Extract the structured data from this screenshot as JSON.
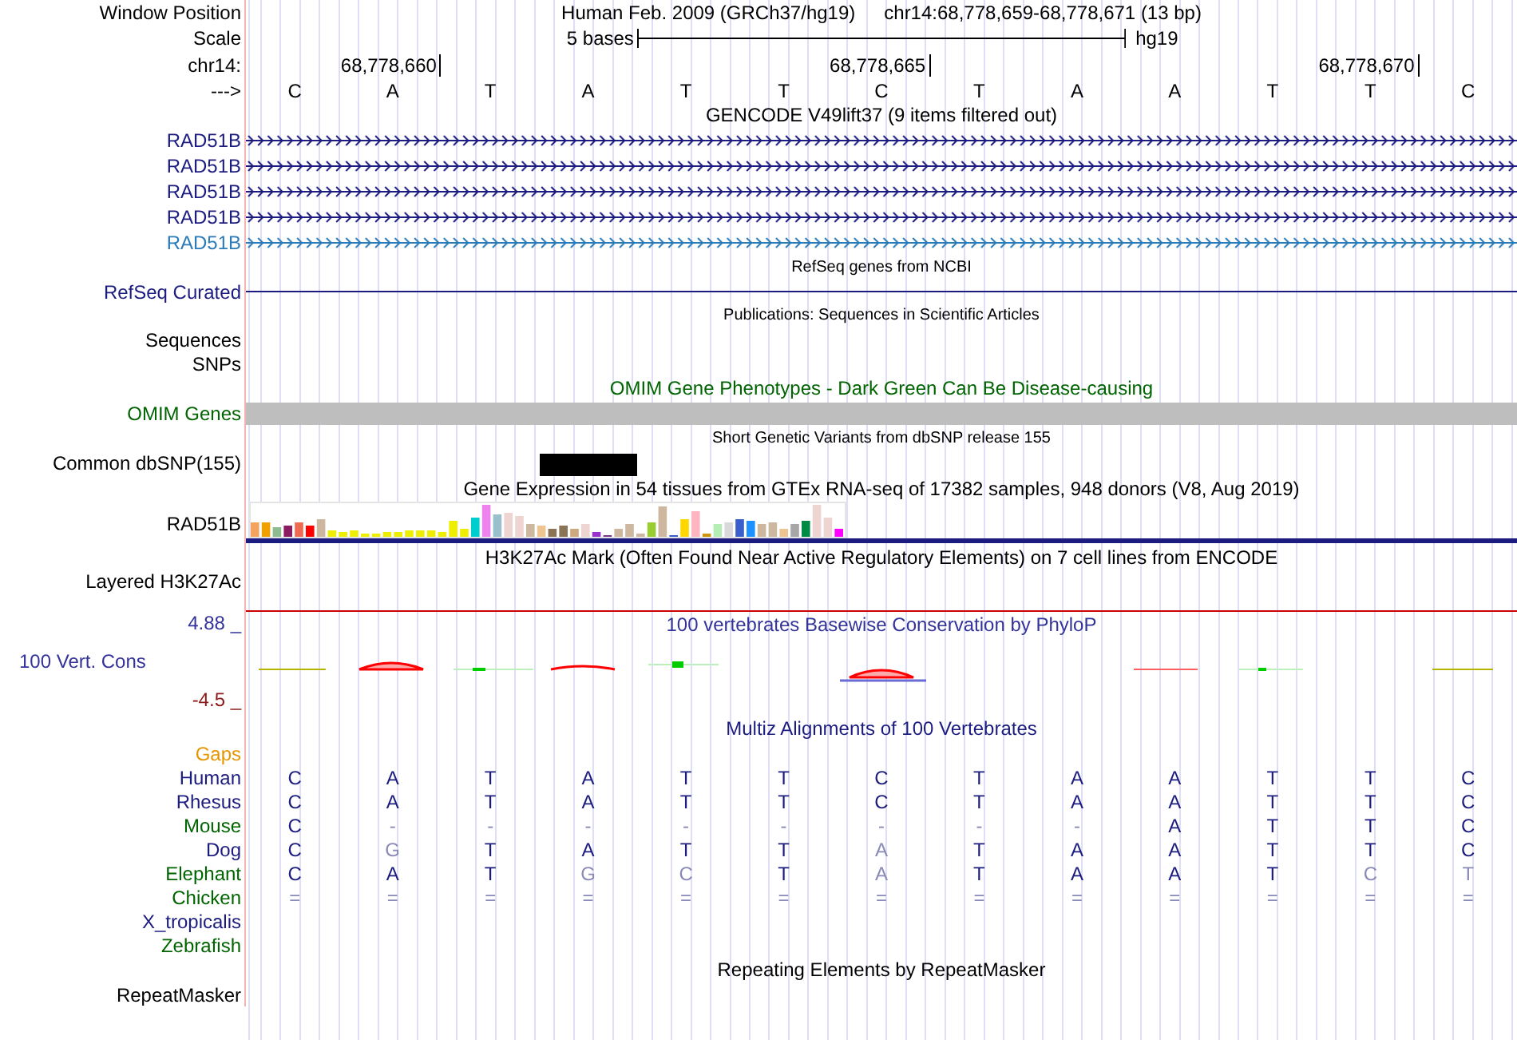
{
  "rows": [
    {
      "kind": "position",
      "label": "Window Position",
      "assembly": "Human Feb. 2009 (GRCh37/hg19)",
      "range": "chr14:68,778,659-68,778,671 (13 bp)"
    },
    {
      "kind": "scale",
      "label": "Scale",
      "span": "5 bases",
      "db": "hg19"
    },
    {
      "kind": "ruler",
      "label": "chr14:",
      "ticks": [
        "68,778,660",
        "68,778,665",
        "68,778,670"
      ]
    },
    {
      "kind": "sequence",
      "label": "--->",
      "bases": [
        "C",
        "A",
        "T",
        "A",
        "T",
        "T",
        "C",
        "T",
        "A",
        "A",
        "T",
        "T",
        "C"
      ]
    },
    {
      "kind": "title",
      "text": "GENCODE V49lift37 (9 items filtered out)",
      "color": "#000000"
    },
    {
      "kind": "gene",
      "label": "RAD51B",
      "color": "#1c1c80"
    },
    {
      "kind": "gene",
      "label": "RAD51B",
      "color": "#1c1c80"
    },
    {
      "kind": "gene",
      "label": "RAD51B",
      "color": "#1c1c80"
    },
    {
      "kind": "gene",
      "label": "RAD51B",
      "color": "#1c1c80"
    },
    {
      "kind": "gene",
      "label": "RAD51B",
      "color": "#2b7bb8"
    },
    {
      "kind": "small_title",
      "text": "RefSeq genes from NCBI"
    },
    {
      "kind": "line",
      "label": "RefSeq Curated",
      "color": "#1c1c80"
    },
    {
      "kind": "small_title",
      "text": "Publications: Sequences in Scientific Articles"
    },
    {
      "kind": "empty",
      "label": "Sequences",
      "color": "#000000"
    },
    {
      "kind": "empty",
      "label": "SNPs",
      "color": "#000000"
    },
    {
      "kind": "title",
      "text": "OMIM Gene Phenotypes - Dark Green Can Be Disease-causing",
      "color": "#006400"
    },
    {
      "kind": "bar",
      "label": "OMIM Genes",
      "color": "#006400"
    },
    {
      "kind": "small_title",
      "text": "Short Genetic Variants from dbSNP release 155"
    },
    {
      "kind": "variant",
      "label": "Common dbSNP(155)"
    },
    {
      "kind": "title",
      "text": "Gene Expression in 54 tissues from GTEx RNA-seq of 17382 samples, 948 donors (V8, Aug 2019)",
      "color": "#000000"
    },
    {
      "kind": "expression",
      "label": "RAD51B"
    },
    {
      "kind": "title",
      "text": "H3K27Ac Mark (Often Found Near Active Regulatory Elements) on 7 cell lines from ENCODE",
      "color": "#000000"
    },
    {
      "kind": "layered",
      "label": "Layered H3K27Ac"
    },
    {
      "kind": "phylop",
      "title": "100 vertebrates Basewise Conservation by PhyloP",
      "max": "4.88 _",
      "label": "100 Vert. Cons",
      "min": "-4.5 _"
    },
    {
      "kind": "title",
      "text": "Multiz Alignments of 100 Vertebrates",
      "color": "#1c1c80"
    },
    {
      "kind": "empty",
      "label": "Gaps",
      "color": "#e69500"
    },
    {
      "kind": "align",
      "label": "Human",
      "color": "#1c1c80",
      "bases": [
        "C",
        "A",
        "T",
        "A",
        "T",
        "T",
        "C",
        "T",
        "A",
        "A",
        "T",
        "T",
        "C"
      ],
      "faded": [
        false,
        false,
        false,
        false,
        false,
        false,
        false,
        false,
        false,
        false,
        false,
        false,
        false
      ]
    },
    {
      "kind": "align",
      "label": "Rhesus",
      "color": "#1c1c80",
      "bases": [
        "C",
        "A",
        "T",
        "A",
        "T",
        "T",
        "C",
        "T",
        "A",
        "A",
        "T",
        "T",
        "C"
      ],
      "faded": [
        false,
        false,
        false,
        false,
        false,
        false,
        false,
        false,
        false,
        false,
        false,
        false,
        false
      ]
    },
    {
      "kind": "align",
      "label": "Mouse",
      "color": "#006400",
      "bases": [
        "C",
        "-",
        "-",
        "-",
        "-",
        "-",
        "-",
        "-",
        "-",
        "A",
        "T",
        "T",
        "C"
      ],
      "faded": [
        false,
        true,
        true,
        true,
        true,
        true,
        true,
        true,
        true,
        false,
        false,
        false,
        false
      ]
    },
    {
      "kind": "align",
      "label": "Dog",
      "color": "#1c1c80",
      "bases": [
        "C",
        "G",
        "T",
        "A",
        "T",
        "T",
        "A",
        "T",
        "A",
        "A",
        "T",
        "T",
        "C"
      ],
      "faded": [
        false,
        true,
        false,
        false,
        false,
        false,
        true,
        false,
        false,
        false,
        false,
        false,
        false
      ]
    },
    {
      "kind": "align",
      "label": "Elephant",
      "color": "#006400",
      "bases": [
        "C",
        "A",
        "T",
        "G",
        "C",
        "T",
        "A",
        "T",
        "A",
        "A",
        "T",
        "C",
        "T"
      ],
      "faded": [
        false,
        false,
        false,
        true,
        true,
        false,
        true,
        false,
        false,
        false,
        false,
        true,
        true
      ]
    },
    {
      "kind": "align",
      "label": "Chicken",
      "color": "#006400",
      "bases": [
        "=",
        "=",
        "=",
        "=",
        "=",
        "=",
        "=",
        "=",
        "=",
        "=",
        "=",
        "=",
        "="
      ],
      "faded": [
        true,
        true,
        true,
        true,
        true,
        true,
        true,
        true,
        true,
        true,
        true,
        true,
        true
      ]
    },
    {
      "kind": "empty",
      "label": "X_tropicalis",
      "color": "#1c1c80"
    },
    {
      "kind": "empty",
      "label": "Zebrafish",
      "color": "#006400"
    },
    {
      "kind": "title",
      "text": "Repeating Elements by RepeatMasker",
      "color": "#000000"
    },
    {
      "kind": "empty",
      "label": "RepeatMasker",
      "color": "#000000"
    }
  ]
}
